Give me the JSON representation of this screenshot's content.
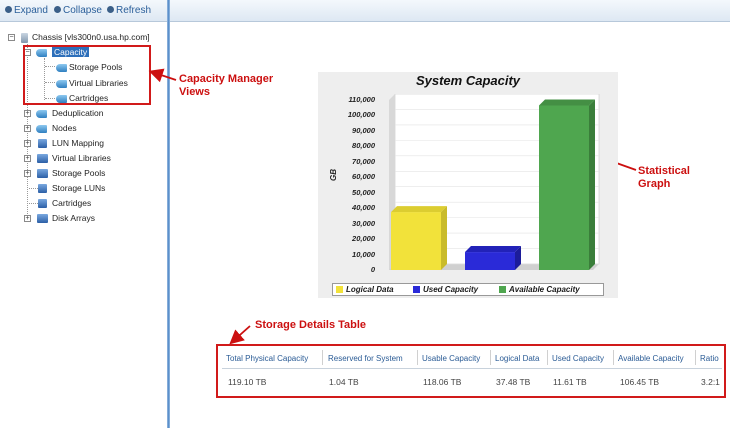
{
  "toolbar": {
    "expand": "Expand",
    "collapse": "Collapse",
    "refresh": "Refresh"
  },
  "tree": {
    "root": "Chassis [vls300n0.usa.hp.com]",
    "capacity": "Capacity",
    "capacity_children": [
      "Storage Pools",
      "Virtual Libraries",
      "Cartridges"
    ],
    "items": [
      "Deduplication",
      "Nodes",
      "LUN Mapping",
      "Virtual Libraries",
      "Storage Pools",
      "Storage LUNs",
      "Cartridges",
      "Disk Arrays"
    ]
  },
  "annotations": {
    "capacity_views": "Capacity Manager\nViews",
    "graph": "Statistical\nGraph",
    "table": "Storage Details Table"
  },
  "chart_data": {
    "type": "bar",
    "title": "System Capacity",
    "ylabel": "GB",
    "ylim": [
      0,
      110000
    ],
    "yticks": [
      "110,000",
      "100,000",
      "90,000",
      "80,000",
      "70,000",
      "60,000",
      "50,000",
      "40,000",
      "30,000",
      "20,000",
      "10,000",
      "0"
    ],
    "series": [
      {
        "name": "Logical Data",
        "value": 37480,
        "color": "#f2e23a"
      },
      {
        "name": "Used Capacity",
        "value": 11610,
        "color": "#2a2ad8"
      },
      {
        "name": "Available Capacity",
        "value": 106450,
        "color": "#4fa64f"
      }
    ]
  },
  "table": {
    "headers": [
      "Total Physical Capacity",
      "Reserved for System",
      "Usable Capacity",
      "Logical Data",
      "Used Capacity",
      "Available Capacity",
      "Ratio"
    ],
    "row": [
      "119.10 TB",
      "1.04 TB",
      "118.06 TB",
      "37.48 TB",
      "11.61 TB",
      "106.45 TB",
      "3.2:1"
    ]
  },
  "colors": {
    "annotation": "#cc1010",
    "link": "#2a5b95",
    "highlight": "#d11a1a"
  }
}
